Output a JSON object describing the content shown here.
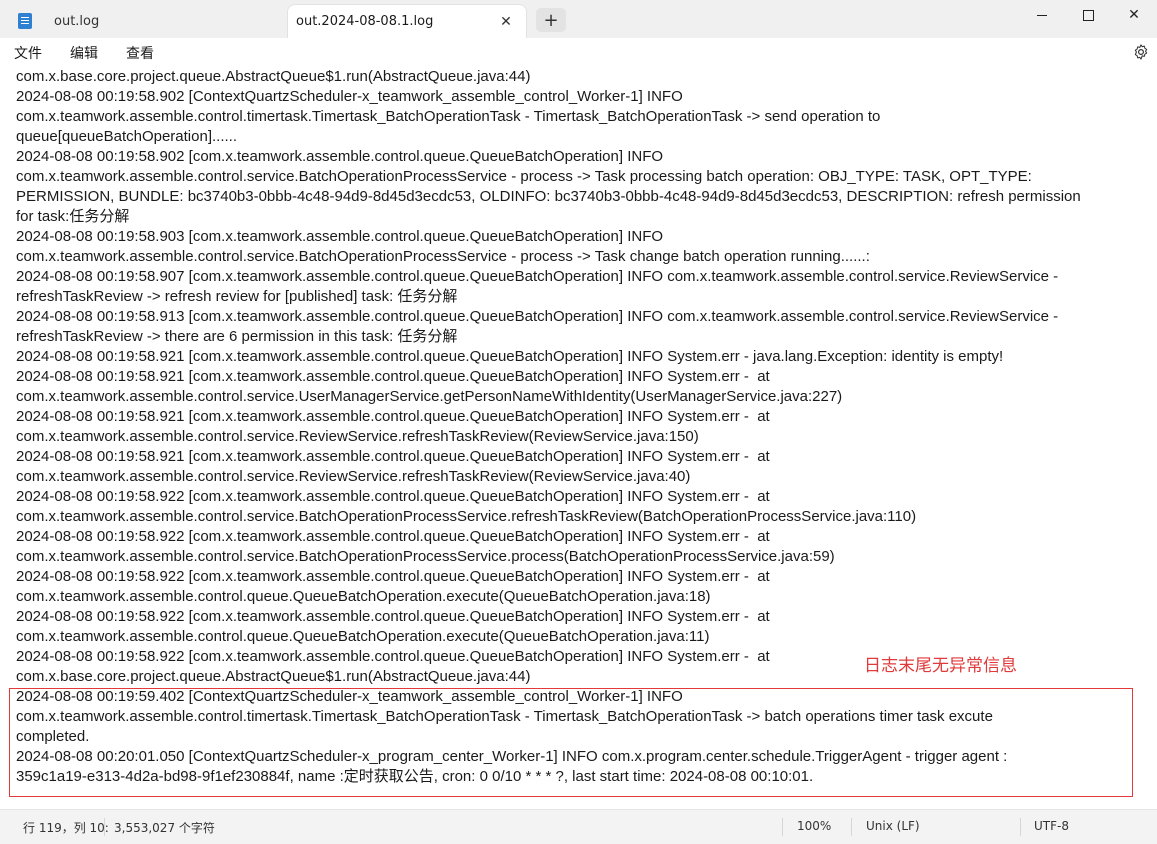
{
  "tabs": [
    {
      "label": "out.log",
      "active": false
    },
    {
      "label": "out.2024-08-08.1.log",
      "active": true
    }
  ],
  "new_tab_label": "+",
  "window_controls": {
    "close": "✕"
  },
  "menu": [
    "文件",
    "编辑",
    "查看"
  ],
  "log_lines": [
    "com.x.base.core.project.queue.AbstractQueue$1.run(AbstractQueue.java:44)",
    "2024-08-08 00:19:58.902 [ContextQuartzScheduler-x_teamwork_assemble_control_Worker-1] INFO",
    "com.x.teamwork.assemble.control.timertask.Timertask_BatchOperationTask - Timertask_BatchOperationTask -> send operation to",
    "queue[queueBatchOperation]......",
    "2024-08-08 00:19:58.902 [com.x.teamwork.assemble.control.queue.QueueBatchOperation] INFO",
    "com.x.teamwork.assemble.control.service.BatchOperationProcessService - process -> Task processing batch operation: OBJ_TYPE: TASK, OPT_TYPE:",
    "PERMISSION, BUNDLE: bc3740b3-0bbb-4c48-94d9-8d45d3ecdc53, OLDINFO: bc3740b3-0bbb-4c48-94d9-8d45d3ecdc53, DESCRIPTION: refresh permission",
    "for task:任务分解",
    "2024-08-08 00:19:58.903 [com.x.teamwork.assemble.control.queue.QueueBatchOperation] INFO",
    "com.x.teamwork.assemble.control.service.BatchOperationProcessService - process -> Task change batch operation running......:",
    "2024-08-08 00:19:58.907 [com.x.teamwork.assemble.control.queue.QueueBatchOperation] INFO com.x.teamwork.assemble.control.service.ReviewService -",
    "refreshTaskReview -> refresh review for [published] task: 任务分解",
    "2024-08-08 00:19:58.913 [com.x.teamwork.assemble.control.queue.QueueBatchOperation] INFO com.x.teamwork.assemble.control.service.ReviewService -",
    "refreshTaskReview -> there are 6 permission in this task: 任务分解",
    "2024-08-08 00:19:58.921 [com.x.teamwork.assemble.control.queue.QueueBatchOperation] INFO System.err - java.lang.Exception: identity is empty!",
    "2024-08-08 00:19:58.921 [com.x.teamwork.assemble.control.queue.QueueBatchOperation] INFO System.err -  at",
    "com.x.teamwork.assemble.control.service.UserManagerService.getPersonNameWithIdentity(UserManagerService.java:227)",
    "2024-08-08 00:19:58.921 [com.x.teamwork.assemble.control.queue.QueueBatchOperation] INFO System.err -  at",
    "com.x.teamwork.assemble.control.service.ReviewService.refreshTaskReview(ReviewService.java:150)",
    "2024-08-08 00:19:58.921 [com.x.teamwork.assemble.control.queue.QueueBatchOperation] INFO System.err -  at",
    "com.x.teamwork.assemble.control.service.ReviewService.refreshTaskReview(ReviewService.java:40)",
    "2024-08-08 00:19:58.922 [com.x.teamwork.assemble.control.queue.QueueBatchOperation] INFO System.err -  at",
    "com.x.teamwork.assemble.control.service.BatchOperationProcessService.refreshTaskReview(BatchOperationProcessService.java:110)",
    "2024-08-08 00:19:58.922 [com.x.teamwork.assemble.control.queue.QueueBatchOperation] INFO System.err -  at",
    "com.x.teamwork.assemble.control.service.BatchOperationProcessService.process(BatchOperationProcessService.java:59)",
    "2024-08-08 00:19:58.922 [com.x.teamwork.assemble.control.queue.QueueBatchOperation] INFO System.err -  at",
    "com.x.teamwork.assemble.control.queue.QueueBatchOperation.execute(QueueBatchOperation.java:18)",
    "2024-08-08 00:19:58.922 [com.x.teamwork.assemble.control.queue.QueueBatchOperation] INFO System.err -  at",
    "com.x.teamwork.assemble.control.queue.QueueBatchOperation.execute(QueueBatchOperation.java:11)",
    "2024-08-08 00:19:58.922 [com.x.teamwork.assemble.control.queue.QueueBatchOperation] INFO System.err -  at",
    "com.x.base.core.project.queue.AbstractQueue$1.run(AbstractQueue.java:44)",
    "2024-08-08 00:19:59.402 [ContextQuartzScheduler-x_teamwork_assemble_control_Worker-1] INFO",
    "com.x.teamwork.assemble.control.timertask.Timertask_BatchOperationTask - Timertask_BatchOperationTask -> batch operations timer task excute",
    "completed.",
    "2024-08-08 00:20:01.050 [ContextQuartzScheduler-x_program_center_Worker-1] INFO com.x.program.center.schedule.TriggerAgent - trigger agent :",
    "359c1a19-e313-4d2a-bd98-9f1ef230884f, name :定时获取公告, cron: 0 0/10 * * * ?, last start time: 2024-08-08 00:10:01."
  ],
  "annotation": "日志末尾无异常信息",
  "annotation_color": "#e03a3a",
  "status": {
    "position": "行 119，列 10:",
    "char_count": "3,553,027 个字符",
    "zoom": "100%",
    "line_ending": "Unix (LF)",
    "encoding": "UTF-8"
  },
  "icons": {
    "notepad": "notepad-icon",
    "settings": "gear-icon"
  }
}
